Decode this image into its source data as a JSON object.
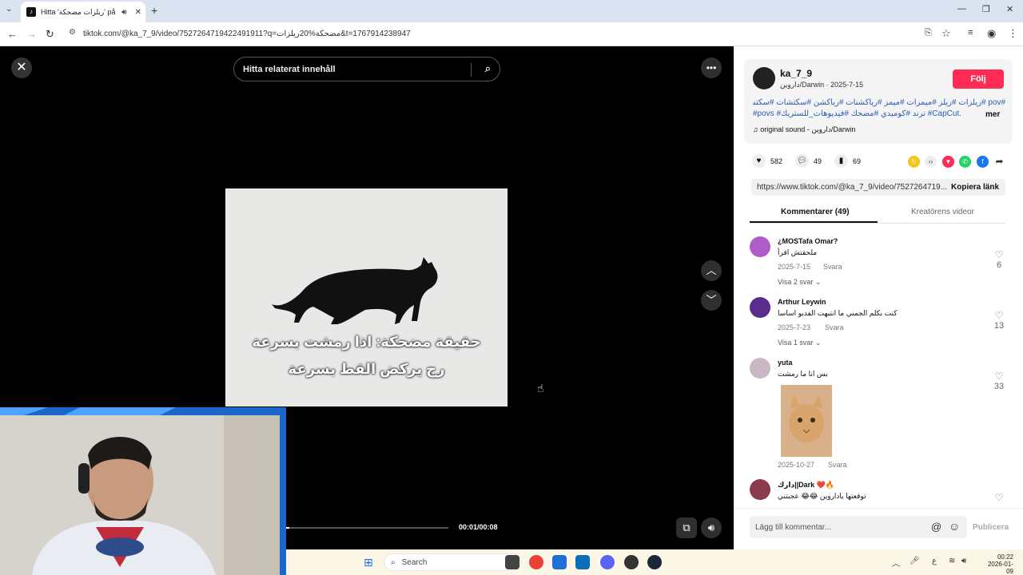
{
  "browser": {
    "tab_title": "Hitta 'ریلزات مضحكة' på TikTok",
    "url": "tiktok.com/@ka_7_9/video/7527264719422491911?q=مضحكة%20ريلزات&t=1767914238947"
  },
  "video": {
    "search_placeholder": "Hitta relaterat innehåll",
    "caption_line1": "حقيقة مضحكة: اذا رمشت بسرعة",
    "caption_line2": "رح يركض القط بسرعة",
    "timecode": "00:01/00:08",
    "progress_fraction": 0.02
  },
  "author": {
    "username": "ka_7_9",
    "display_name": "داروين/Darwin",
    "date": "2025-7-15",
    "follow_label": "Följ",
    "tags_line1": "#pov #ريلزات #ريلز #ميمزات #ميمز #رياكشنات #رياكشن #سكتشات #سكتش",
    "tags_line2": "#povs #ترند #كوميدي #مضحك #فيديوهات_للستريك #CapCut...",
    "more_label": "mer",
    "sound": "original sound - داروين/Darwin"
  },
  "stats": {
    "likes": "582",
    "comments": "49",
    "saves": "69"
  },
  "share": {
    "link": "https://www.tiktok.com/@ka_7_9/video/7527264719...",
    "copy_label": "Kopiera länk"
  },
  "tabs": {
    "comments": "Kommentarer (49)",
    "creator": "Kreatörens videor"
  },
  "comments": [
    {
      "name": "¿MOSTafa Omar?",
      "text": "ملحقتش اقرأ",
      "date": "2025-7-15",
      "reply": "Svara",
      "replies": "Visa 2 svar",
      "likes": "6"
    },
    {
      "name": "Arthur Leywin",
      "text": "كنت بكلم الجمني ما انتبهت الفديو اساسا",
      "date": "2025-7-23",
      "reply": "Svara",
      "replies": "Visa 1 svar",
      "likes": "13"
    },
    {
      "name": "yuta",
      "text": "بس انا ما رمشت",
      "date": "2025-10-27",
      "reply": "Svara",
      "likes": "33"
    },
    {
      "name": "دارك||Dark",
      "text": "توقعتها ياداروين 😂😂 عجبتني"
    }
  ],
  "composer": {
    "placeholder": "Lägg till kommentar...",
    "publish_label": "Publicera"
  },
  "taskbar": {
    "search": "Search",
    "time": "00:22",
    "date": "2026-01-09"
  },
  "colors": {
    "accent": "#fe2c55",
    "hashtag": "#2b5db0"
  }
}
